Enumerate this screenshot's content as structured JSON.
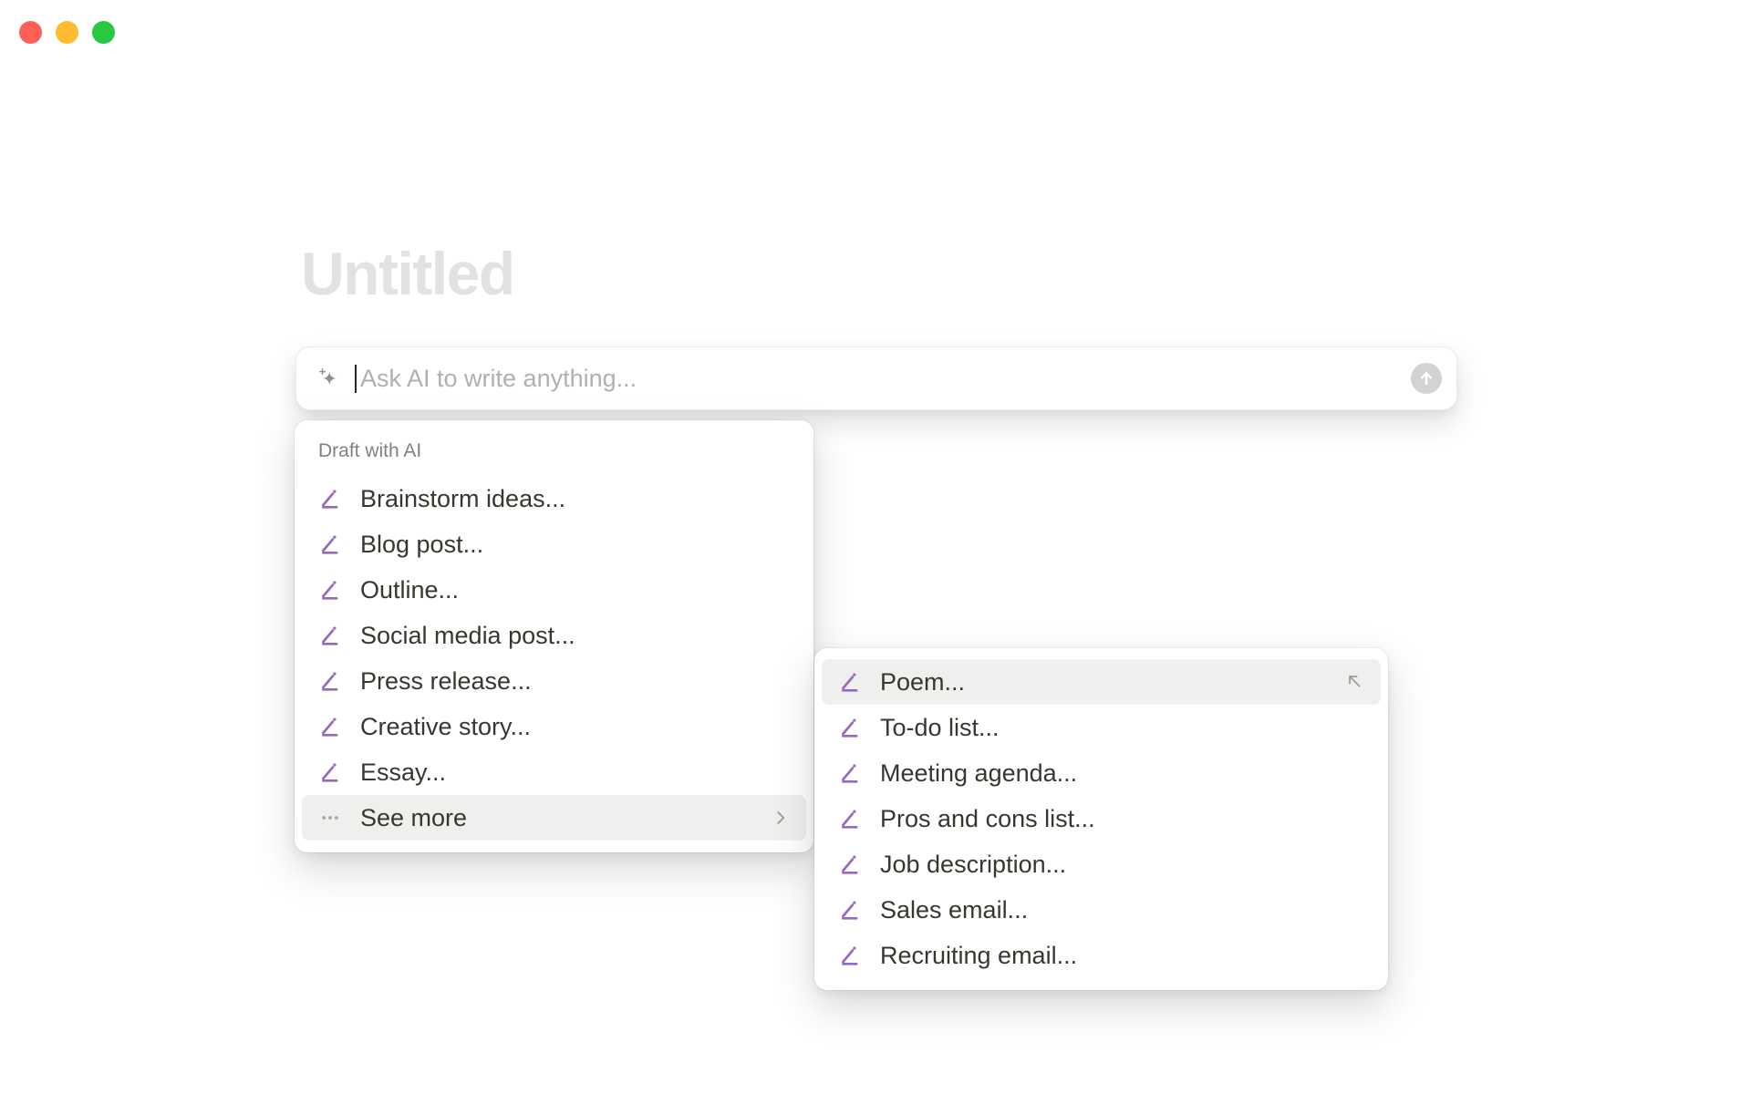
{
  "window": {
    "controls": [
      {
        "name": "close",
        "color": "#ff5f57"
      },
      {
        "name": "minimize",
        "color": "#febc2e"
      },
      {
        "name": "zoom",
        "color": "#2ac840"
      }
    ]
  },
  "page": {
    "title_placeholder": "Untitled"
  },
  "ai_input": {
    "placeholder": "Ask AI to write anything...",
    "leading_icon": "ai-sparkle-icon",
    "send_icon": "arrow-up-icon"
  },
  "draft_menu": {
    "header": "Draft with AI",
    "items": [
      {
        "label": "Brainstorm ideas...",
        "icon": "pen-icon"
      },
      {
        "label": "Blog post...",
        "icon": "pen-icon"
      },
      {
        "label": "Outline...",
        "icon": "pen-icon"
      },
      {
        "label": "Social media post...",
        "icon": "pen-icon"
      },
      {
        "label": "Press release...",
        "icon": "pen-icon"
      },
      {
        "label": "Creative story...",
        "icon": "pen-icon"
      },
      {
        "label": "Essay...",
        "icon": "pen-icon"
      }
    ],
    "see_more": {
      "label": "See more",
      "icon": "ellipsis-icon",
      "trailing_icon": "chevron-right-icon",
      "highlighted": true
    }
  },
  "see_more_submenu": {
    "items": [
      {
        "label": "Poem...",
        "icon": "pen-icon",
        "selected": true,
        "trailing_icon": "arrow-up-left-icon"
      },
      {
        "label": "To-do list...",
        "icon": "pen-icon"
      },
      {
        "label": "Meeting agenda...",
        "icon": "pen-icon"
      },
      {
        "label": "Pros and cons list...",
        "icon": "pen-icon"
      },
      {
        "label": "Job description...",
        "icon": "pen-icon"
      },
      {
        "label": "Sales email...",
        "icon": "pen-icon"
      },
      {
        "label": "Recruiting email...",
        "icon": "pen-icon"
      }
    ]
  },
  "colors": {
    "accent_purple": "#9669be",
    "text_dark": "#38372f",
    "text_gray": "#82827c",
    "placeholder_gray": "#b0b0ad",
    "title_placeholder_gray": "#e2e2e0",
    "row_highlight": "#efefee",
    "icon_gray": "#9b9b97",
    "send_button_gray": "#d3d3d1"
  }
}
